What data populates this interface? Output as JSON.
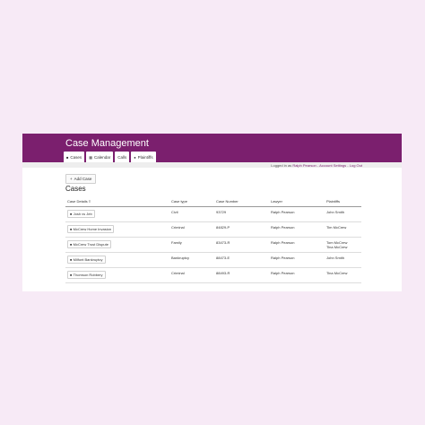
{
  "header": {
    "title": "Case Management"
  },
  "tabs": [
    {
      "label": "Cases",
      "icon": "briefcase-icon"
    },
    {
      "label": "Calendar",
      "icon": "calendar-icon"
    },
    {
      "label": "Calls",
      "icon": "phone-icon"
    },
    {
      "label": "Plaintiffs",
      "icon": "users-icon"
    }
  ],
  "userbar": {
    "prefix": "Logged in as",
    "user": "Ralph Pearson",
    "settings": "Account Settings",
    "logout": "Log Out",
    "sep": "-"
  },
  "add_case_label": "Add Case",
  "section_title": "Cases",
  "table": {
    "headers": {
      "details": "Case Details",
      "type": "Case type",
      "number": "Case Number",
      "lawyer": "Lawyer",
      "plaintiffs": "Plaintiffs"
    },
    "rows": [
      {
        "name": "Josh vs Jeb",
        "type": "Civil",
        "number": "93729",
        "lawyer": "Ralph Pearson",
        "plaintiffs": [
          "John Smith"
        ]
      },
      {
        "name": "McCrew Home Invasion",
        "type": "Criminal",
        "number": "84829-P",
        "lawyer": "Ralph Pearson",
        "plaintiffs": [
          "Tim McCrew"
        ]
      },
      {
        "name": "McCrew Trust Dispute",
        "type": "Family",
        "number": "83473-R",
        "lawyer": "Ralph Pearson",
        "plaintiffs": [
          "Tom McCrew",
          "Tina McCrew"
        ]
      },
      {
        "name": "Milfont Bankruptcy",
        "type": "Bankruptcy",
        "number": "88473-E",
        "lawyer": "Ralph Pearson",
        "plaintiffs": [
          "John Smith"
        ]
      },
      {
        "name": "Thomson Robbery",
        "type": "Criminal",
        "number": "88493-R",
        "lawyer": "Ralph Pearson",
        "plaintiffs": [
          "Tina McCrew"
        ]
      }
    ]
  },
  "colors": {
    "brand": "#7b1f6e",
    "background": "#f7eaf6"
  }
}
